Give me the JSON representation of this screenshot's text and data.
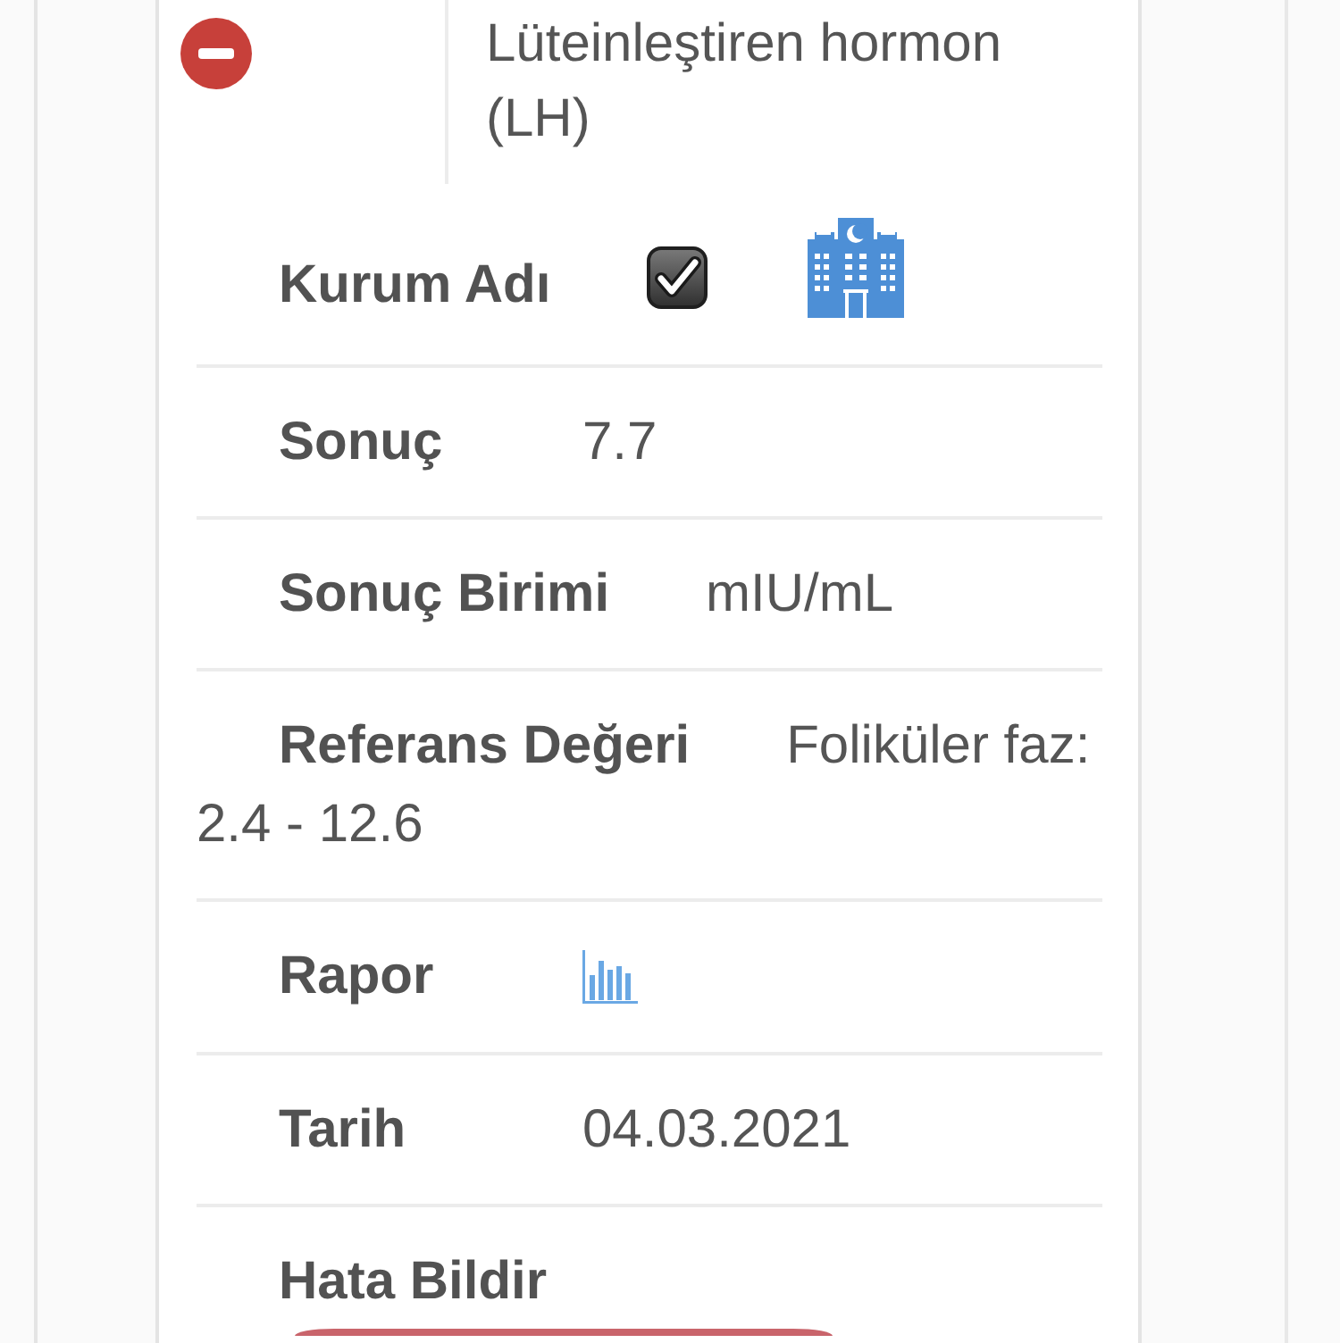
{
  "record": {
    "expanded": true,
    "title": "Lüteinleştiren hormon (LH)"
  },
  "fields": [
    {
      "kind": "icons",
      "label": "Kurum Adı",
      "checked": true
    },
    {
      "kind": "text",
      "label": "Sonuç",
      "value": "7.7"
    },
    {
      "kind": "text",
      "label": "Sonuç Birimi",
      "value": "mIU/mL"
    },
    {
      "kind": "text",
      "label": "Referans Değeri",
      "value": "Foliküler faz: 2.4 - 12.6"
    },
    {
      "kind": "chart",
      "label": "Rapor"
    },
    {
      "kind": "text",
      "label": "Tarih",
      "value": "04.03.2021"
    },
    {
      "kind": "button",
      "label": "Hata Bildir"
    }
  ]
}
